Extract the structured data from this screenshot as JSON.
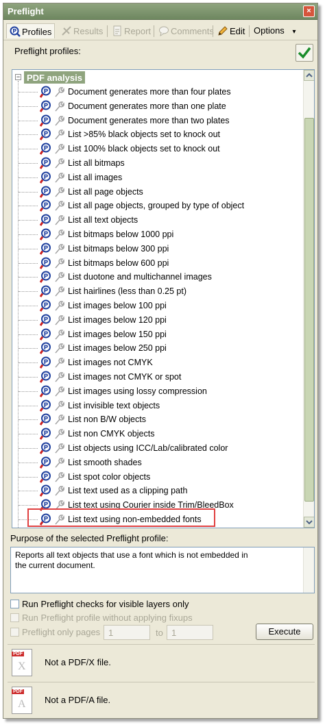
{
  "window": {
    "title": "Preflight",
    "close_glyph": "×"
  },
  "toolbar": {
    "profiles": "Profiles",
    "results": "Results",
    "report": "Report",
    "comments": "Comments",
    "edit": "Edit",
    "options": "Options",
    "options_arrow": "▾"
  },
  "profiles_label": "Preflight profiles:",
  "tree": {
    "root": "PDF analysis",
    "items": [
      "Document generates more than four plates",
      "Document generates more than one plate",
      "Document generates more than two plates",
      "List >85% black objects set to knock out",
      "List 100% black objects set to knock out",
      "List all bitmaps",
      "List all images",
      "List all page objects",
      "List all page objects, grouped by type of object",
      "List all text objects",
      "List bitmaps below 1000 ppi",
      "List bitmaps below 300 ppi",
      "List bitmaps below 600 ppi",
      "List duotone and multichannel images",
      "List hairlines (less than 0.25 pt)",
      "List images below 100 ppi",
      "List images below 120 ppi",
      "List images below 150 ppi",
      "List images below 250 ppi",
      "List images not CMYK",
      "List images not CMYK or spot",
      "List images using lossy compression",
      "List invisible text objects",
      "List non B/W objects",
      "List non CMYK objects",
      "List objects using ICC/Lab/calibrated color",
      "List smooth shades",
      "List spot color objects",
      "List text used as a clipping path",
      "List text using Courier inside Trim/BleedBox",
      "List text using non-embedded fonts"
    ]
  },
  "purpose": {
    "label": "Purpose of the selected Preflight profile:",
    "line1": "Reports all text objects that use a font which is not embedded in",
    "line2": "the current document."
  },
  "options": {
    "visible_layers": "Run Preflight checks for visible layers only",
    "no_fixups": "Run Preflight profile without applying fixups",
    "only_pages": "Preflight only pages",
    "from_page": "1",
    "to_label": "to",
    "to_page": "1",
    "execute": "Execute"
  },
  "status": {
    "pdfx_tag": "PDF",
    "pdfx_letter": "X",
    "pdfx": "Not a PDF/X file.",
    "pdfa_tag": "PDF",
    "pdfa_letter": "A",
    "pdfa": "Not a PDF/A file."
  },
  "colors": {
    "accent": "#8fa47e",
    "highlight": "#e04040"
  }
}
